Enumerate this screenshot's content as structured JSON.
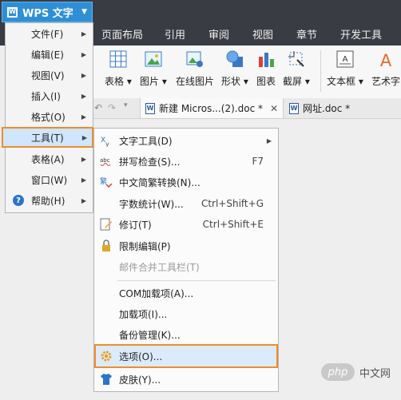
{
  "app": {
    "title": "WPS 文字",
    "logo_glyph": "W",
    "accent": "#2f8fd6",
    "highlight": "#f08c2a"
  },
  "ribbon_tabs": [
    "页面布局",
    "引用",
    "审阅",
    "视图",
    "章节",
    "开发工具"
  ],
  "toolbar": [
    {
      "label": "表格",
      "icon": "table-icon",
      "has_menu": true
    },
    {
      "label": "图片",
      "icon": "picture-icon",
      "has_menu": true
    },
    {
      "label": "在线图片",
      "icon": "online-picture-icon",
      "has_menu": false
    },
    {
      "label": "形状",
      "icon": "shape-icon",
      "has_menu": true
    },
    {
      "label": "图表",
      "icon": "chart-icon",
      "has_menu": false
    },
    {
      "label": "截屏",
      "icon": "screenshot-icon",
      "has_menu": true
    },
    {
      "label": "文本框",
      "icon": "textbox-icon",
      "has_menu": true
    },
    {
      "label": "艺术字",
      "icon": "wordart-icon",
      "has_menu": false
    }
  ],
  "doc_tabs": [
    {
      "label": "新建 Micros...(2).doc *",
      "close": "✕"
    },
    {
      "label": "网址.doc *"
    }
  ],
  "main_menu": [
    {
      "label": "文件(F)",
      "arrow": "▶"
    },
    {
      "label": "编辑(E)",
      "arrow": "▶"
    },
    {
      "label": "视图(V)",
      "arrow": "▶"
    },
    {
      "label": "插入(I)",
      "arrow": "▶"
    },
    {
      "label": "格式(O)",
      "arrow": "▶"
    },
    {
      "label": "工具(T)",
      "arrow": "▶",
      "active": true
    },
    {
      "label": "表格(A)",
      "arrow": "▶"
    },
    {
      "label": "窗口(W)",
      "arrow": "▶"
    },
    {
      "label": "帮助(H)",
      "arrow": "▶",
      "icon": "help-icon"
    }
  ],
  "tools_submenu": [
    {
      "label": "文字工具(D)",
      "arrow": "▶",
      "icon": "text-tools-icon"
    },
    {
      "label": "拼写检查(S)...",
      "shortcut": "F7",
      "icon": "spellcheck-icon"
    },
    {
      "label": "中文简繁转换(N)...",
      "icon": "chinese-convert-icon"
    },
    {
      "label": "字数统计(W)...",
      "shortcut": "Ctrl+Shift+G"
    },
    {
      "label": "修订(T)",
      "shortcut": "Ctrl+Shift+E",
      "icon": "revision-icon"
    },
    {
      "label": "限制编辑(P)",
      "icon": "lock-icon"
    },
    {
      "label": "邮件合并工具栏(T)",
      "disabled": true
    },
    {
      "label": "COM加载项(A)..."
    },
    {
      "label": "加载项(I)..."
    },
    {
      "label": "备份管理(K)..."
    },
    {
      "label": "选项(O)...",
      "icon": "gear-icon",
      "active": true
    },
    {
      "label": "皮肤(Y)...",
      "icon": "shirt-icon"
    }
  ],
  "watermark": {
    "badge": "php",
    "text": "中文网"
  }
}
